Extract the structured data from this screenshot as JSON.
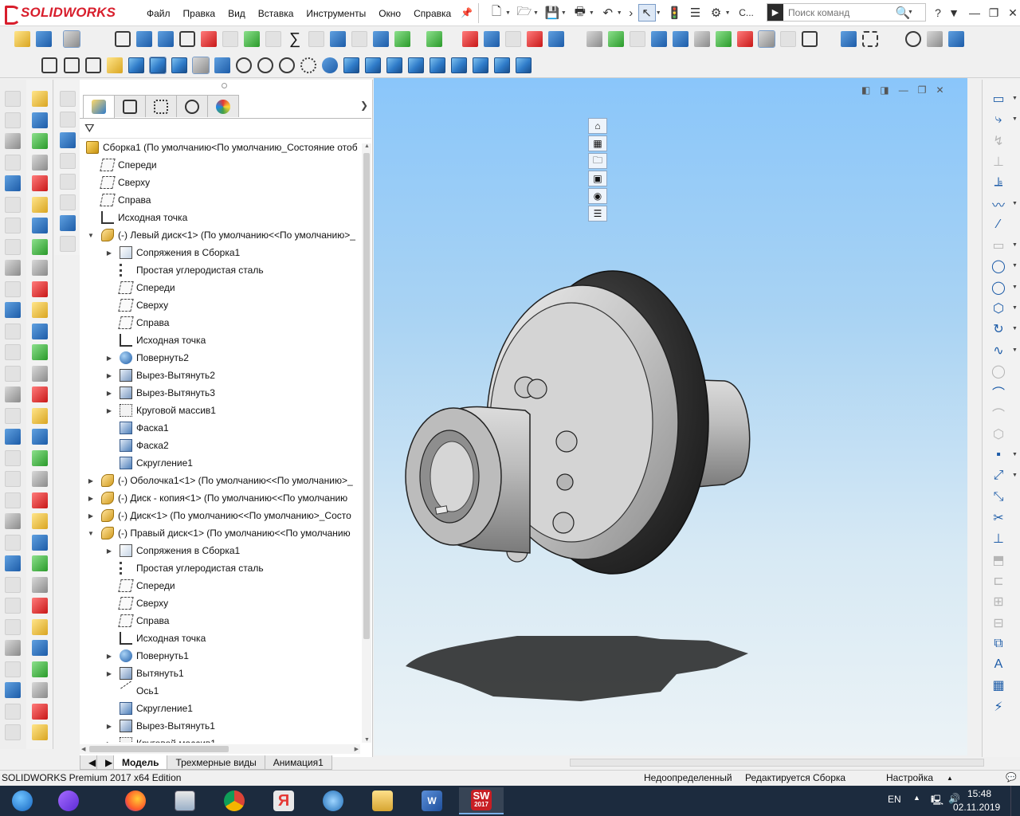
{
  "app": {
    "logo_text": "SOLIDWORKS",
    "menu": [
      "Файл",
      "Правка",
      "Вид",
      "Вставка",
      "Инструменты",
      "Окно",
      "Справка"
    ],
    "search_placeholder": "Поиск команд",
    "overflow_label": "С..."
  },
  "feature_tree": {
    "rows": [
      {
        "label": "Сборка1  (По умолчанию<По умолчанию_Состояние отоб",
        "icon": "assembly-icon",
        "level": 0,
        "expander": ""
      },
      {
        "label": "Спереди",
        "icon": "plane-icon",
        "level": 1,
        "expander": ""
      },
      {
        "label": "Сверху",
        "icon": "plane-icon",
        "level": 1,
        "expander": ""
      },
      {
        "label": "Справа",
        "icon": "plane-icon",
        "level": 1,
        "expander": ""
      },
      {
        "label": "Исходная точка",
        "icon": "origin-icon",
        "level": 1,
        "expander": ""
      },
      {
        "label": "(-) Левый диск<1> (По умолчанию<<По умолчанию>_",
        "icon": "part-icon",
        "level": 1,
        "expander": "▼"
      },
      {
        "label": "Сопряжения в Сборка1",
        "icon": "mates-icon",
        "level": 2,
        "expander": "▶"
      },
      {
        "label": "Простая углеродистая сталь",
        "icon": "material-icon",
        "level": 2,
        "expander": ""
      },
      {
        "label": "Спереди",
        "icon": "plane-icon",
        "level": 2,
        "expander": ""
      },
      {
        "label": "Сверху",
        "icon": "plane-icon",
        "level": 2,
        "expander": ""
      },
      {
        "label": "Справа",
        "icon": "plane-icon",
        "level": 2,
        "expander": ""
      },
      {
        "label": "Исходная точка",
        "icon": "origin-icon",
        "level": 2,
        "expander": ""
      },
      {
        "label": "Повернуть2",
        "icon": "revolve-icon",
        "level": 2,
        "expander": "▶"
      },
      {
        "label": "Вырез-Вытянуть2",
        "icon": "extrude-cut-icon",
        "level": 2,
        "expander": "▶"
      },
      {
        "label": "Вырез-Вытянуть3",
        "icon": "extrude-cut-icon",
        "level": 2,
        "expander": "▶"
      },
      {
        "label": "Круговой массив1",
        "icon": "circular-pattern-icon",
        "level": 2,
        "expander": "▶"
      },
      {
        "label": "Фаска1",
        "icon": "chamfer-icon",
        "level": 2,
        "expander": ""
      },
      {
        "label": "Фаска2",
        "icon": "chamfer-icon",
        "level": 2,
        "expander": ""
      },
      {
        "label": "Скругление1",
        "icon": "fillet-icon",
        "level": 2,
        "expander": ""
      },
      {
        "label": "(-) Оболочка1<1> (По умолчанию<<По умолчанию>_",
        "icon": "part-icon",
        "level": 1,
        "expander": "▶"
      },
      {
        "label": "(-) Диск - копия<1> (По умолчанию<<По умолчанию",
        "icon": "part-icon",
        "level": 1,
        "expander": "▶"
      },
      {
        "label": "(-) Диск<1> (По умолчанию<<По умолчанию>_Состо",
        "icon": "part-icon",
        "level": 1,
        "expander": "▶"
      },
      {
        "label": "(-) Правый диск<1> (По умолчанию<<По умолчанию",
        "icon": "part-icon",
        "level": 1,
        "expander": "▼"
      },
      {
        "label": "Сопряжения в Сборка1",
        "icon": "mates-icon",
        "level": 2,
        "expander": "▶"
      },
      {
        "label": "Простая углеродистая сталь",
        "icon": "material-icon",
        "level": 2,
        "expander": ""
      },
      {
        "label": "Спереди",
        "icon": "plane-icon",
        "level": 2,
        "expander": ""
      },
      {
        "label": "Сверху",
        "icon": "plane-icon",
        "level": 2,
        "expander": ""
      },
      {
        "label": "Справа",
        "icon": "plane-icon",
        "level": 2,
        "expander": ""
      },
      {
        "label": "Исходная точка",
        "icon": "origin-icon",
        "level": 2,
        "expander": ""
      },
      {
        "label": "Повернуть1",
        "icon": "revolve-icon",
        "level": 2,
        "expander": "▶"
      },
      {
        "label": "Вытянуть1",
        "icon": "extrude-cut-icon",
        "level": 2,
        "expander": "▶"
      },
      {
        "label": "Ось1",
        "icon": "axis-icon",
        "level": 2,
        "expander": ""
      },
      {
        "label": "Скругление1",
        "icon": "fillet-icon",
        "level": 2,
        "expander": ""
      },
      {
        "label": "Вырез-Вытянуть1",
        "icon": "extrude-cut-icon",
        "level": 2,
        "expander": "▶"
      },
      {
        "label": "Круговой массив1",
        "icon": "circular-pattern-icon",
        "level": 2,
        "expander": "▶"
      }
    ]
  },
  "bottom_tabs": [
    "Модель",
    "Трехмерные виды",
    "Анимация1"
  ],
  "status": {
    "edition": "SOLIDWORKS Premium 2017 x64 Edition",
    "definition": "Недоопределенный",
    "editing": "Редактируется Сборка",
    "settings": "Настройка"
  },
  "tray": {
    "lang": "EN",
    "time": "15:48",
    "date": "02.11.2019"
  },
  "taskbar_sw_badge": "2017",
  "colors": {
    "brand_red": "#d81e2c",
    "viewport_top": "#8ac6fa",
    "viewport_bottom": "#ecf3f6",
    "taskbar": "#1c2b3e"
  }
}
